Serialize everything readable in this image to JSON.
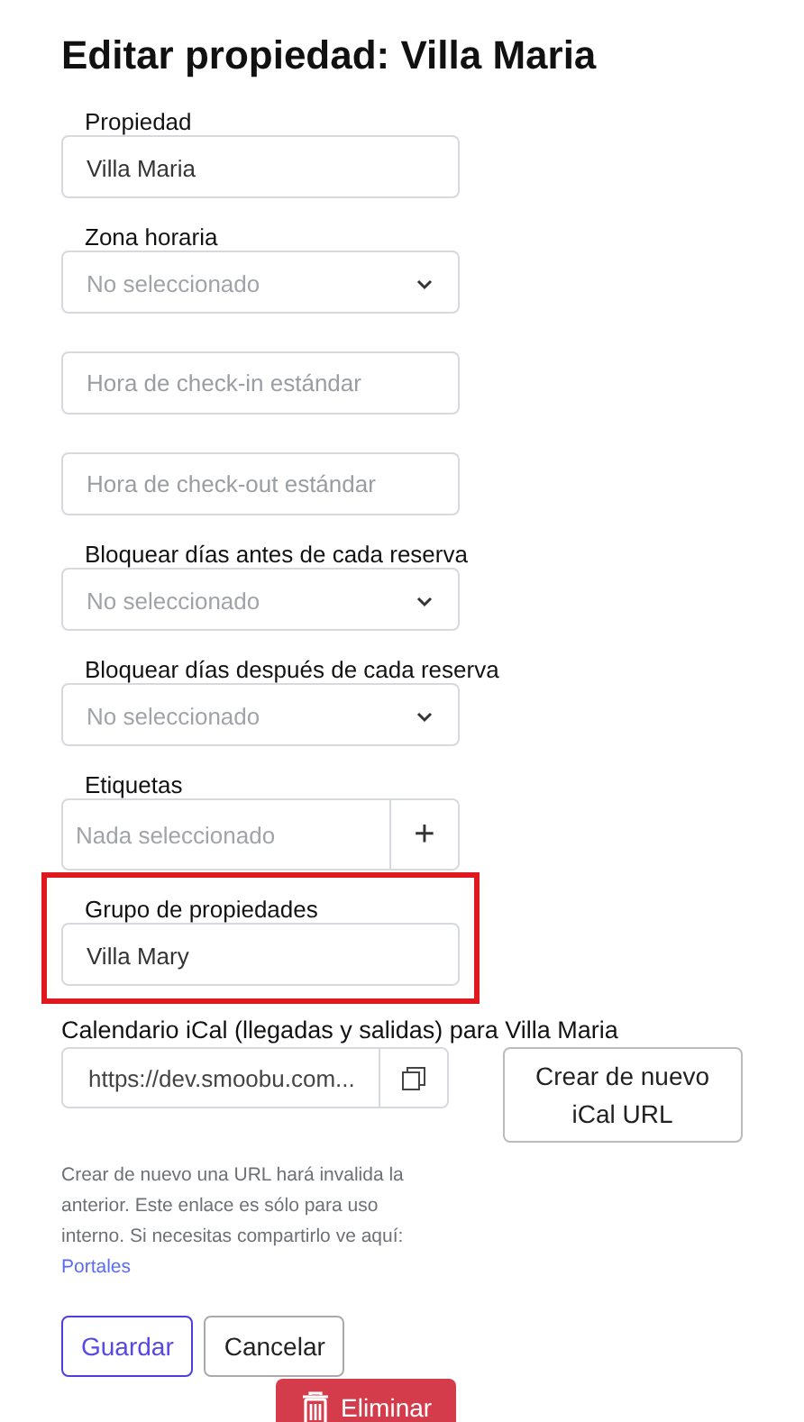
{
  "title": "Editar propiedad: Villa Maria",
  "fields": [
    {
      "kind": "text",
      "label": "Propiedad",
      "value": "Villa Maria",
      "highlighted": false
    },
    {
      "kind": "select",
      "label": "Zona horaria",
      "placeholder": "No seleccionado",
      "highlighted": false
    },
    {
      "kind": "input",
      "placeholder": "Hora de check-in estándar",
      "highlighted": false
    },
    {
      "kind": "input",
      "placeholder": "Hora de check-out estándar",
      "highlighted": false
    },
    {
      "kind": "select",
      "label": "Bloquear días antes de cada reserva",
      "placeholder": "No seleccionado",
      "highlighted": false
    },
    {
      "kind": "select",
      "label": "Bloquear días después de cada reserva",
      "placeholder": "No seleccionado",
      "highlighted": false
    },
    {
      "kind": "tags",
      "label": "Etiquetas",
      "placeholder": "Nada seleccionado",
      "add": "+",
      "highlighted": false
    },
    {
      "kind": "text",
      "label": "Grupo de propiedades",
      "value": "Villa Mary",
      "highlighted": true
    }
  ],
  "ical": {
    "label": "Calendario iCal (llegadas y salidas) para Villa Maria",
    "url": "https://dev.smoobu.com...",
    "regenerate": "Crear de nuevo iCal URL",
    "help": "Crear de nuevo una URL hará invalida la anterior. Este enlace es sólo para uso interno. Si necesitas compartirlo ve aquí:",
    "link": "Portales"
  },
  "buttons": {
    "save": "Guardar",
    "cancel": "Cancelar",
    "delete": "Eliminar"
  }
}
